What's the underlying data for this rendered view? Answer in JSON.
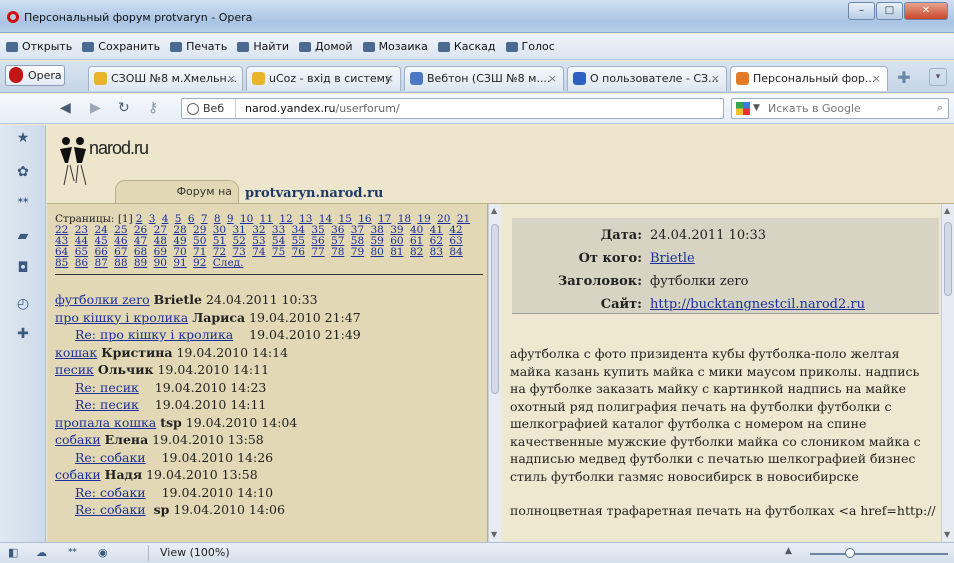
{
  "window": {
    "title": "Персональный форум protvaryn - Opera",
    "minimize": "–",
    "maximize": "□",
    "close": "✕"
  },
  "menubar": {
    "items": [
      "Открыть",
      "Сохранить",
      "Печать",
      "Найти",
      "Домой",
      "Мозаика",
      "Каскад",
      "Голос"
    ]
  },
  "tabs": {
    "opera_button": "Opera",
    "items": [
      {
        "label": "СЗОШ №8 м.Хмельн...",
        "color": "#e8b52a"
      },
      {
        "label": "uCoz - вхід в систему",
        "color": "#e8b52a"
      },
      {
        "label": "Вебтон (СЗШ №8 м....",
        "color": "#4a7ac6"
      },
      {
        "label": "О пользователе - СЗ...",
        "color": "#2f62c0"
      },
      {
        "label": "Персональный фор...",
        "color": "#e27b25"
      }
    ],
    "close": "×",
    "new_tab": "✚",
    "menu": "▾"
  },
  "addressbar": {
    "web_badge": "Веб",
    "url_prefix": "",
    "url_domain": "narod.yandex.ru",
    "url_path": "/userforum/",
    "search_placeholder": "Искать в Google"
  },
  "header": {
    "logo_text": "narod.ru",
    "forum_tab": "Форум на",
    "site_name": "protvaryn.narod.ru"
  },
  "pages": {
    "label": "Страницы:",
    "current": "[1]",
    "numbers": [
      "2",
      "3",
      "4",
      "5",
      "6",
      "7",
      "8",
      "9",
      "10",
      "11",
      "12",
      "13",
      "14",
      "15",
      "16",
      "17",
      "18",
      "19",
      "20",
      "21",
      "22",
      "23",
      "24",
      "25",
      "26",
      "27",
      "28",
      "29",
      "30",
      "31",
      "32",
      "33",
      "34",
      "35",
      "36",
      "37",
      "38",
      "39",
      "40",
      "41",
      "42",
      "43",
      "44",
      "45",
      "46",
      "47",
      "48",
      "49",
      "50",
      "51",
      "52",
      "53",
      "54",
      "55",
      "56",
      "57",
      "58",
      "59",
      "60",
      "61",
      "62",
      "63",
      "64",
      "65",
      "66",
      "67",
      "68",
      "69",
      "70",
      "71",
      "72",
      "73",
      "74",
      "75",
      "76",
      "77",
      "78",
      "79",
      "80",
      "81",
      "82",
      "83",
      "84",
      "85",
      "86",
      "87",
      "88",
      "89",
      "90",
      "91",
      "92"
    ],
    "next": "След."
  },
  "posts": [
    {
      "title": "футболки zero",
      "author": "Brietle",
      "date": "24.04.2011 10:33",
      "reply": false
    },
    {
      "title": "про кішку і кролика",
      "author": "Лариса",
      "date": "19.04.2010 21:47",
      "reply": false
    },
    {
      "title": "Re: про кішку і кролика",
      "author": "",
      "date": "19.04.2010 21:49",
      "reply": true
    },
    {
      "title": "кошак",
      "author": "Кристина",
      "date": "19.04.2010 14:14",
      "reply": false
    },
    {
      "title": "песик",
      "author": "Ольчик",
      "date": "19.04.2010 14:11",
      "reply": false
    },
    {
      "title": "Re: песик",
      "author": "",
      "date": "19.04.2010 14:23",
      "reply": true
    },
    {
      "title": "Re: песик",
      "author": "",
      "date": "19.04.2010 14:11",
      "reply": true
    },
    {
      "title": "пропала кошка",
      "author": "tsp",
      "date": "19.04.2010 14:04",
      "reply": false
    },
    {
      "title": "собаки",
      "author": "Елена",
      "date": "19.04.2010 13:58",
      "reply": false
    },
    {
      "title": "Re: собаки",
      "author": "",
      "date": "19.04.2010 14:26",
      "reply": true
    },
    {
      "title": "собаки",
      "author": "Надя",
      "date": "19.04.2010 13:58",
      "reply": false
    },
    {
      "title": "Re: собаки",
      "author": "",
      "date": "19.04.2010 14:10",
      "reply": true
    },
    {
      "title": "Re: собаки",
      "author": "sp",
      "date": "19.04.2010 14:06",
      "reply": true
    }
  ],
  "message": {
    "date_label": "Дата:",
    "date": "24.04.2011 10:33",
    "from_label": "От кого:",
    "from": "Brietle",
    "subject_label": "Заголовок:",
    "subject": "футболки zero",
    "site_label": "Сайт:",
    "site": "http://bucktangnestcil.narod2.ru",
    "body1": "афутболка с фото призидента кубы футболка-поло желтая майка казань купить майка с мики маусом приколы. надпись на футболке заказать майку с картинкой надпись на майке охотный ряд полиграфия печать на футболки футболки с шелкографией каталог футболка с номером на спине качественные мужские футболки майка со слоником майка с надписью медвед футболки с печатью шелкографией бизнес стиль футболки газмяс новосибирск в новосибирске",
    "body2": "полноцветная трафаретная печать на футболках <a href=http://"
  },
  "statusbar": {
    "zoom": "View (100%)"
  }
}
